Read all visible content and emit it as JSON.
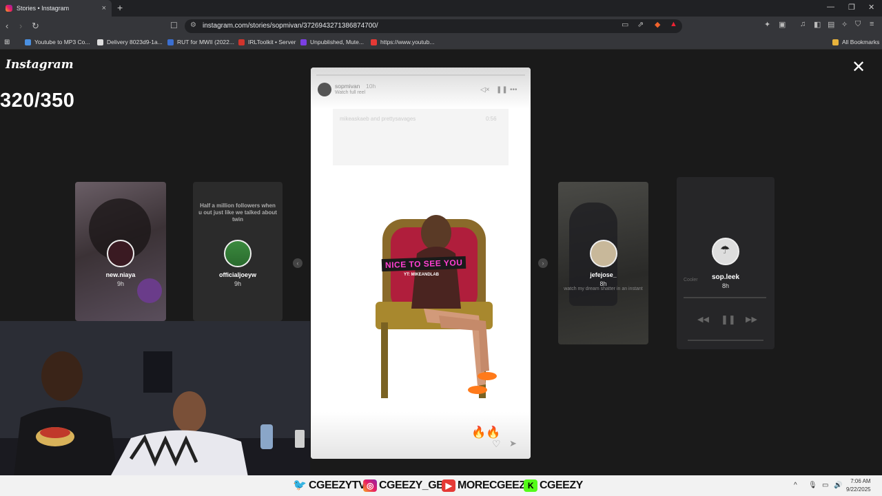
{
  "browser": {
    "tab_title": "Stories • Instagram",
    "tab_close": "×",
    "new_tab": "+",
    "url": "instagram.com/stories/sopmivan/3726943271386874700/",
    "bookmarks": [
      {
        "label": "Youtube to MP3 Co...",
        "color": "#4a90e2"
      },
      {
        "label": "Delivery 8023d9-1a...",
        "color": "#ffffff"
      },
      {
        "label": "RUT for MWII (2022...",
        "color": "#3b6fd1"
      },
      {
        "label": "IRLToolkit • Server",
        "color": "#d0342c"
      },
      {
        "label": "Unpublished, Mute...",
        "color": "#7b3fe4"
      },
      {
        "label": "https://www.youtub...",
        "color": "#e53935"
      }
    ],
    "all_bookmarks": "All Bookmarks"
  },
  "viewer": {
    "logo": "Instagram",
    "overlay_count": "320/350",
    "close": "✕",
    "previews": [
      {
        "name": "new.niaya",
        "time": "9h"
      },
      {
        "name": "officialjoeyw",
        "time": "9h",
        "caption": "Half a million followers when u out just like we talked about twin"
      },
      {
        "name": "jefejose_",
        "time": "8h",
        "caption": "watch my dream shatter in an instant"
      },
      {
        "name": "sop.leek",
        "time": "8h",
        "song": "Cooler"
      }
    ]
  },
  "story": {
    "username": "sopmivan",
    "time": "10h",
    "watch_reel": "Watch full reel",
    "faded_text": "mikeaskaeb and prettysavages",
    "faded_time": "0:56",
    "overlay_text": "NICE TO SEE YOU",
    "tag": "YT: MIKEANDLAB",
    "reaction": "🔥🔥"
  },
  "stream": {
    "twitter": "CGEEZYTV",
    "instagram": "CGEEZY_GBC",
    "youtube": "MORECGEEZY",
    "kick": "CGEEZY"
  },
  "taskbar": {
    "time": "7:06 AM",
    "date": "9/22/2025"
  },
  "colors": {
    "chrome_bg": "#35363a",
    "viewer_bg": "#1a1a1a",
    "magenta_text": "#ff3fd2"
  }
}
